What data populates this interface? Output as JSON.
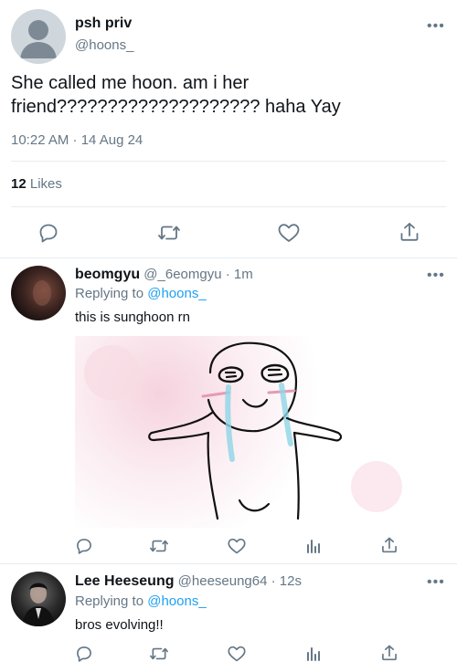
{
  "main_tweet": {
    "display_name": "psh priv",
    "handle": "@hoons_",
    "text_line1": "She called me hoon. am i her",
    "text_line2": "friend???????????????????? haha Yay",
    "timestamp": "10:22 AM · 14 Aug 24",
    "likes_count": "12",
    "likes_label": "Likes"
  },
  "replies": [
    {
      "display_name": "beomgyu",
      "handle": "@_6eomgyu",
      "time": "· 1m",
      "replying_prefix": "Replying to",
      "replying_to": "@hoons_",
      "text": "this is sunghoon rn"
    },
    {
      "display_name": "Lee Heeseung",
      "handle": "@heeseung64",
      "time": "· 12s",
      "replying_prefix": "Replying to",
      "replying_to": "@hoons_",
      "text": "bros evolving!!"
    }
  ],
  "icons": {
    "more": "•••",
    "reply": "reply-icon",
    "retweet": "retweet-icon",
    "like": "heart-icon",
    "share": "share-icon",
    "analytics": "analytics-icon"
  },
  "colors": {
    "accent": "#1da1f2",
    "muted": "#657786",
    "divider": "#e6ecf0"
  }
}
